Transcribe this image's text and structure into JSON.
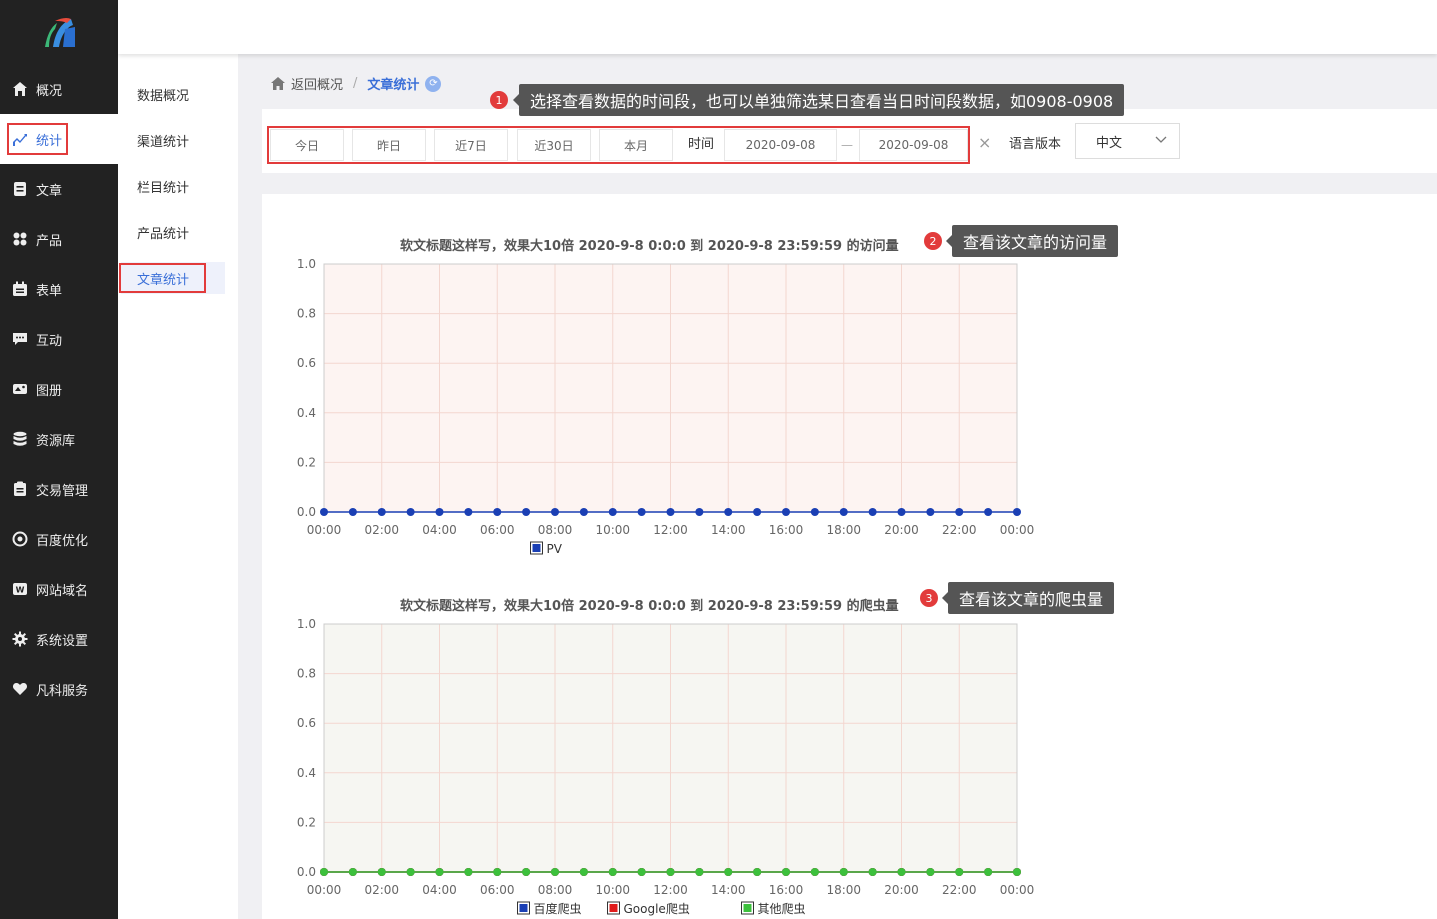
{
  "sidebar": {
    "items": [
      {
        "label": "概况",
        "icon": "home-icon"
      },
      {
        "label": "统计",
        "icon": "chart-icon",
        "active": true
      },
      {
        "label": "文章",
        "icon": "article-icon"
      },
      {
        "label": "产品",
        "icon": "grid-icon"
      },
      {
        "label": "表单",
        "icon": "calendar-icon"
      },
      {
        "label": "互动",
        "icon": "chat-icon"
      },
      {
        "label": "图册",
        "icon": "album-icon"
      },
      {
        "label": "资源库",
        "icon": "database-icon"
      },
      {
        "label": "交易管理",
        "icon": "clipboard-icon"
      },
      {
        "label": "百度优化",
        "icon": "target-icon"
      },
      {
        "label": "网站域名",
        "icon": "web-icon"
      },
      {
        "label": "系统设置",
        "icon": "gear-icon"
      },
      {
        "label": "凡科服务",
        "icon": "heart-icon"
      }
    ]
  },
  "subnav": {
    "items": [
      {
        "label": "数据概况"
      },
      {
        "label": "渠道统计"
      },
      {
        "label": "栏目统计"
      },
      {
        "label": "产品统计"
      },
      {
        "label": "文章统计",
        "active": true
      }
    ]
  },
  "breadcrumb": {
    "back": "返回概况",
    "sep": "/",
    "current": "文章统计"
  },
  "filters": {
    "buttons": [
      "今日",
      "昨日",
      "近7日",
      "近30日",
      "本月"
    ],
    "time_label": "时间",
    "start_date": "2020-09-08",
    "end_date": "2020-09-08",
    "dash": "—",
    "clear": "×",
    "lang_label": "语言版本",
    "lang_value": "中文"
  },
  "tooltips": [
    {
      "num": "1",
      "text": "选择查看数据的时间段，也可以单独筛选某日查看当日时间段数据，如0908-0908"
    },
    {
      "num": "2",
      "text": "查看该文章的访问量"
    },
    {
      "num": "3",
      "text": "查看该文章的爬虫量"
    }
  ],
  "colors": {
    "accent": "#3a6fd8",
    "highlight": "#e23b3b",
    "sidebar_bg": "#222222",
    "pv": "#1a3fb4",
    "baidu": "#1a3fb4",
    "google": "#e01b1b",
    "other": "#3cc03c"
  },
  "chart_data": [
    {
      "type": "line",
      "title": "软文标题这样写，效果大10倍 2020-9-8 0:0:0 到 2020-9-8 23:59:59 的访问量",
      "x": [
        "00:00",
        "01:00",
        "02:00",
        "03:00",
        "04:00",
        "05:00",
        "06:00",
        "07:00",
        "08:00",
        "09:00",
        "10:00",
        "11:00",
        "12:00",
        "13:00",
        "14:00",
        "15:00",
        "16:00",
        "17:00",
        "18:00",
        "19:00",
        "20:00",
        "21:00",
        "22:00",
        "23:00",
        "00:00"
      ],
      "xticks": [
        "00:00",
        "02:00",
        "04:00",
        "06:00",
        "08:00",
        "10:00",
        "12:00",
        "14:00",
        "16:00",
        "18:00",
        "20:00",
        "22:00",
        "00:00"
      ],
      "ylim": [
        0,
        1.0
      ],
      "yticks": [
        "0.0",
        "0.2",
        "0.4",
        "0.6",
        "0.8",
        "1.0"
      ],
      "grid": true,
      "legend": "bottom",
      "series": [
        {
          "name": "PV",
          "color": "#1a3fb4",
          "values": [
            0,
            0,
            0,
            0,
            0,
            0,
            0,
            0,
            0,
            0,
            0,
            0,
            0,
            0,
            0,
            0,
            0,
            0,
            0,
            0,
            0,
            0,
            0,
            0,
            0
          ]
        }
      ]
    },
    {
      "type": "line",
      "title": "软文标题这样写，效果大10倍 2020-9-8 0:0:0 到 2020-9-8 23:59:59 的爬虫量",
      "x": [
        "00:00",
        "01:00",
        "02:00",
        "03:00",
        "04:00",
        "05:00",
        "06:00",
        "07:00",
        "08:00",
        "09:00",
        "10:00",
        "11:00",
        "12:00",
        "13:00",
        "14:00",
        "15:00",
        "16:00",
        "17:00",
        "18:00",
        "19:00",
        "20:00",
        "21:00",
        "22:00",
        "23:00",
        "00:00"
      ],
      "xticks": [
        "00:00",
        "02:00",
        "04:00",
        "06:00",
        "08:00",
        "10:00",
        "12:00",
        "14:00",
        "16:00",
        "18:00",
        "20:00",
        "22:00",
        "00:00"
      ],
      "ylim": [
        0,
        1.0
      ],
      "yticks": [
        "0.0",
        "0.2",
        "0.4",
        "0.6",
        "0.8",
        "1.0"
      ],
      "grid": true,
      "legend": "bottom",
      "series": [
        {
          "name": "百度爬虫",
          "color": "#1a3fb4",
          "values": [
            0,
            0,
            0,
            0,
            0,
            0,
            0,
            0,
            0,
            0,
            0,
            0,
            0,
            0,
            0,
            0,
            0,
            0,
            0,
            0,
            0,
            0,
            0,
            0,
            0
          ]
        },
        {
          "name": "Google爬虫",
          "color": "#e01b1b",
          "values": [
            0,
            0,
            0,
            0,
            0,
            0,
            0,
            0,
            0,
            0,
            0,
            0,
            0,
            0,
            0,
            0,
            0,
            0,
            0,
            0,
            0,
            0,
            0,
            0,
            0
          ]
        },
        {
          "name": "其他爬虫",
          "color": "#3cc03c",
          "values": [
            0,
            0,
            0,
            0,
            0,
            0,
            0,
            0,
            0,
            0,
            0,
            0,
            0,
            0,
            0,
            0,
            0,
            0,
            0,
            0,
            0,
            0,
            0,
            0,
            0
          ]
        }
      ]
    }
  ]
}
